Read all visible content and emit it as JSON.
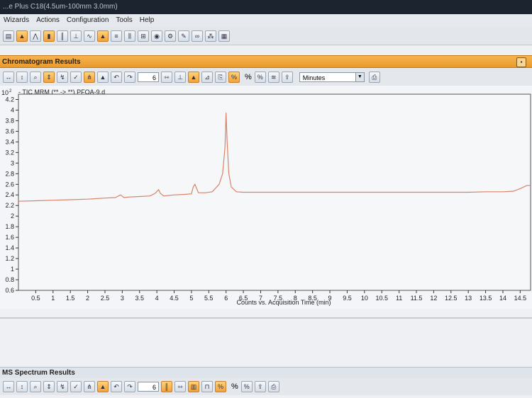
{
  "window": {
    "title_partial": "...e Plus C18(4.5um-100mm 3.0mm)"
  },
  "menu": [
    "Wizards",
    "Actions",
    "Configuration",
    "Tools",
    "Help"
  ],
  "chromatogram_panel": {
    "title": "Chromatogram Results",
    "step_value": "6",
    "x_unit": "Minutes",
    "pct_label": "%"
  },
  "spectrum_panel": {
    "title": "MS Spectrum Results",
    "step_value": "6",
    "pct_label": "%"
  },
  "chart_data": {
    "type": "line",
    "trace_label": "- TIC MRM (** -> **) PFOA-9.d",
    "y_multiplier": "10",
    "y_exponent": "2",
    "xlabel": "Counts vs. Acquisition Time (min)",
    "ylabel": "",
    "xlim": [
      0.0,
      14.8
    ],
    "ylim": [
      0.6,
      4.3
    ],
    "x_ticks": [
      "0.5",
      "1",
      "1.5",
      "2",
      "2.5",
      "3",
      "3.5",
      "4",
      "4.5",
      "5",
      "5.5",
      "6",
      "6.5",
      "7",
      "7.5",
      "8",
      "8.5",
      "9",
      "9.5",
      "10",
      "10.5",
      "11",
      "11.5",
      "12",
      "12.5",
      "13",
      "13.5",
      "14",
      "14.5"
    ],
    "y_ticks": [
      "0.6",
      "0.8",
      "1",
      "1.2",
      "1.4",
      "1.6",
      "1.8",
      "2",
      "2.2",
      "2.4",
      "2.6",
      "2.8",
      "3",
      "3.2",
      "3.4",
      "3.6",
      "3.8",
      "4",
      "4.2"
    ],
    "grid": false,
    "line_color": "#d9826a",
    "series": [
      {
        "x": [
          0.0,
          0.5,
          1.0,
          1.5,
          2.0,
          2.5,
          2.8,
          2.95,
          3.05,
          3.2,
          3.5,
          3.8,
          3.95,
          4.05,
          4.1,
          4.2,
          4.5,
          4.8,
          5.0,
          5.05,
          5.1,
          5.2,
          5.4,
          5.6,
          5.8,
          5.9,
          5.97,
          6.0,
          6.03,
          6.08,
          6.15,
          6.3,
          6.5,
          7.0,
          7.5,
          8.0,
          8.5,
          9.0,
          9.5,
          10.0,
          10.5,
          11.0,
          11.5,
          12.0,
          12.5,
          13.0,
          13.5,
          14.0,
          14.3,
          14.5,
          14.7,
          14.8
        ],
        "y": [
          2.28,
          2.29,
          2.3,
          2.31,
          2.32,
          2.34,
          2.35,
          2.4,
          2.35,
          2.36,
          2.37,
          2.38,
          2.43,
          2.5,
          2.43,
          2.38,
          2.4,
          2.41,
          2.42,
          2.55,
          2.6,
          2.44,
          2.44,
          2.46,
          2.6,
          2.8,
          3.3,
          3.95,
          3.4,
          2.8,
          2.55,
          2.46,
          2.45,
          2.45,
          2.45,
          2.45,
          2.45,
          2.45,
          2.45,
          2.45,
          2.45,
          2.45,
          2.45,
          2.45,
          2.45,
          2.45,
          2.46,
          2.46,
          2.47,
          2.52,
          2.58,
          2.58
        ]
      }
    ]
  }
}
